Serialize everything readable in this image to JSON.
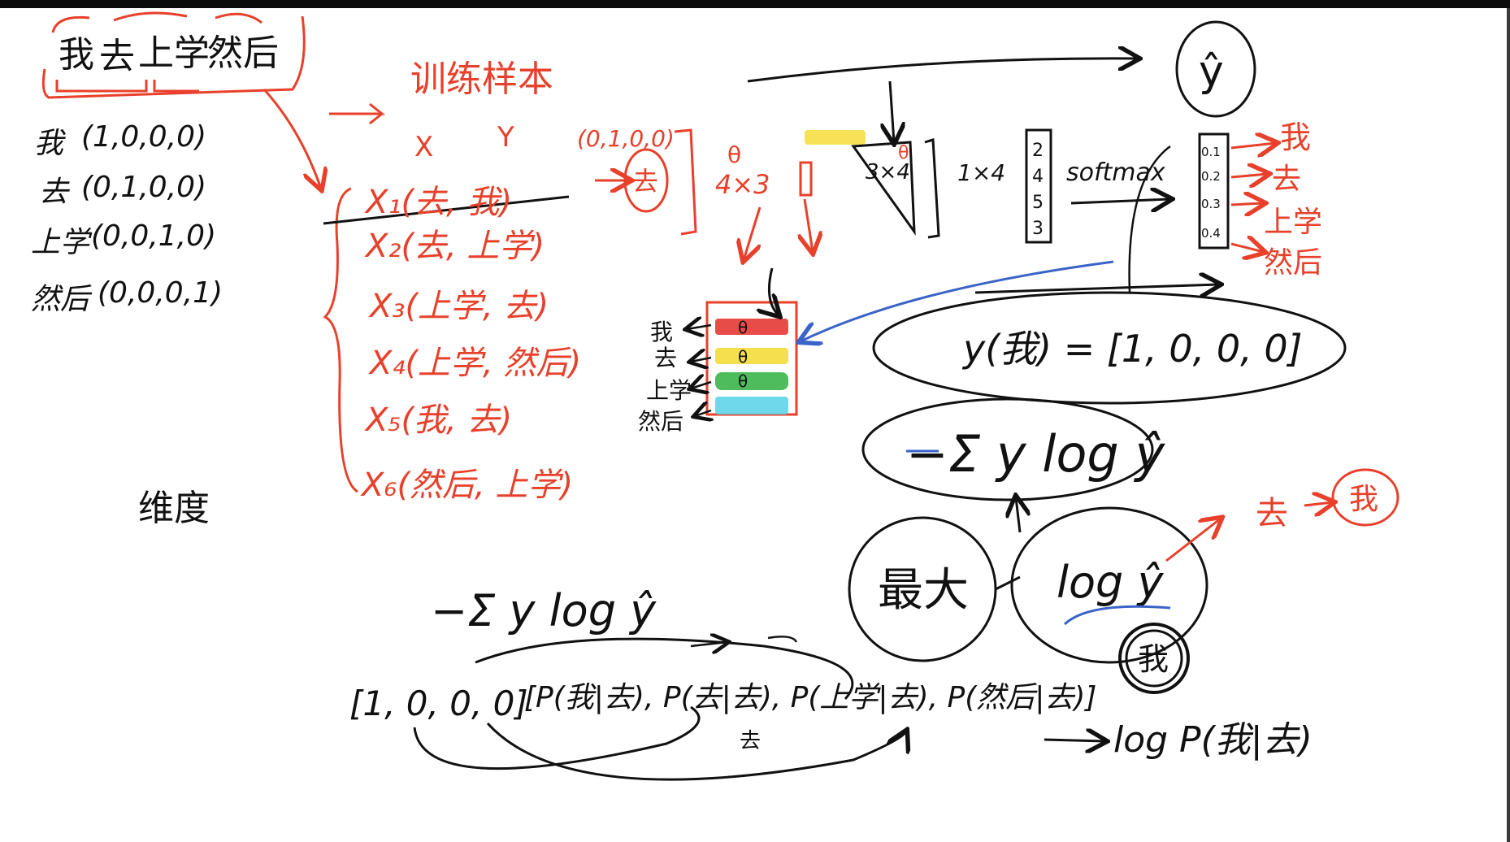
{
  "colors": {
    "black_ink": "#111111",
    "red_ink": "#e8402a",
    "blue_ink": "#3a63c8",
    "highlight_red": "#e53935",
    "highlight_yellow": "#f4dc3a",
    "highlight_green": "#3bb54a",
    "highlight_cyan": "#5fd4e8",
    "background": "#ffffff"
  },
  "sentence": {
    "words": [
      "我",
      "去",
      "上学",
      "然后"
    ]
  },
  "one_hot": [
    {
      "word": "我",
      "vector": "(1,0,0,0)"
    },
    {
      "word": "去",
      "vector": "(0,1,0,0)"
    },
    {
      "word": "上学",
      "vector": "(0,0,1,0)"
    },
    {
      "word": "然后",
      "vector": "(0,0,0,1)"
    }
  ],
  "dimension_label": "维度",
  "training_samples": {
    "title": "训练样本",
    "header": {
      "x": "X",
      "y": "Y"
    },
    "rows": [
      "X₁(去, 我)",
      "X₂(去, 上学)",
      "X₃(上学, 去)",
      "X₄(上学, 然后)",
      "X₅(我, 去)",
      "X₆(然后, 上学)"
    ]
  },
  "network": {
    "input_vector": "(0,1,0,0)",
    "input_word": "去",
    "weight_label": "θ",
    "weight_shape": "4×3",
    "second_shape": "3×4",
    "output_shape": "1×4",
    "output_values": [
      "2",
      "4",
      "5",
      "3"
    ],
    "softmax_label": "softmax",
    "y_hat": "ŷ",
    "probs": [
      "0.1",
      "0.2",
      "0.3",
      "0.4"
    ],
    "prob_words": [
      "我",
      "去",
      "上学",
      "然后"
    ]
  },
  "embedding_table": {
    "rows": [
      {
        "word": "我",
        "mark": "θ"
      },
      {
        "word": "去",
        "mark": "θ"
      },
      {
        "word": "上学",
        "mark": "θ"
      },
      {
        "word": "然后",
        "mark": ""
      }
    ]
  },
  "loss": {
    "y_target": "y(我) = [1, 0, 0, 0]",
    "cross_entropy": "−Σ y log ŷ",
    "maximize": "最大",
    "log_y_hat": "log ŷ",
    "target_word_circled": "我",
    "pair_left": "去",
    "pair_right": "我"
  },
  "bottom": {
    "formula": "−Σ y log ŷ",
    "one_hot": "[1, 0, 0, 0]",
    "prob_list": "[P(我|去), P(去|去), P(上学|去), P(然后|去)]",
    "under_label": "去",
    "result": "log P(我|去)"
  }
}
